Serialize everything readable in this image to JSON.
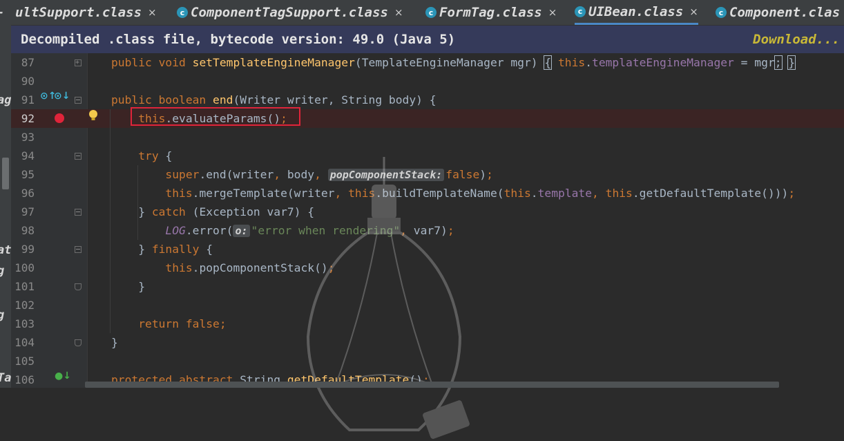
{
  "left_strip": {
    "fragments": [
      "-",
      "ag",
      "at",
      "g",
      "g",
      "Ta"
    ]
  },
  "tabs": [
    {
      "label": "ultSupport.class",
      "icon": "class-icon",
      "active": false
    },
    {
      "label": "ComponentTagSupport.class",
      "icon": "class-icon",
      "active": false
    },
    {
      "label": "FormTag.class",
      "icon": "class-icon",
      "active": false
    },
    {
      "label": "UIBean.class",
      "icon": "class-icon",
      "active": true
    },
    {
      "label": "Component.clas",
      "icon": "class-icon",
      "active": false
    }
  ],
  "tab_close_glyph": "×",
  "class_icon_glyph": "c",
  "banner": {
    "text": "Decompiled .class file, bytecode version: 49.0 (Java 5)",
    "link": "Download..."
  },
  "lines": [
    {
      "n": "87",
      "segments": [
        [
          "kw",
          "public void "
        ],
        [
          "fn",
          "setTemplateEngineManager"
        ],
        [
          "",
          "(TemplateEngineManager mgr) "
        ],
        [
          "bracket",
          "{"
        ],
        [
          "",
          ""
        ],
        [
          "kw",
          " this"
        ],
        [
          "",
          "."
        ],
        [
          "fld",
          "templateEngineManager"
        ],
        [
          "",
          " = mgr"
        ],
        [
          "bracket",
          ";"
        ],
        [
          "",
          " "
        ],
        [
          "bracket",
          "}"
        ]
      ]
    },
    {
      "n": "90",
      "segments": []
    },
    {
      "n": "91",
      "segments": [
        [
          "kw",
          "public boolean "
        ],
        [
          "fn",
          "end"
        ],
        [
          "",
          "(Writer writer, String body) {"
        ]
      ]
    },
    {
      "n": "92",
      "segments": [
        [
          "",
          "    "
        ],
        [
          "kw",
          "this"
        ],
        [
          "",
          ".evaluateParams()"
        ],
        [
          "kw",
          ";"
        ]
      ]
    },
    {
      "n": "93",
      "segments": []
    },
    {
      "n": "94",
      "segments": [
        [
          "",
          "    "
        ],
        [
          "kw",
          "try "
        ],
        [
          "",
          "{"
        ]
      ]
    },
    {
      "n": "95",
      "segments": [
        [
          "",
          "        "
        ],
        [
          "kw",
          "super"
        ],
        [
          "",
          ".end(writer"
        ],
        [
          "kw",
          ", "
        ],
        [
          "",
          "body"
        ],
        [
          "kw",
          ", "
        ],
        [
          "hint",
          "popComponentStack:"
        ],
        [
          "kw",
          "false"
        ],
        [
          "",
          ")"
        ],
        [
          "kw",
          ";"
        ]
      ]
    },
    {
      "n": "96",
      "segments": [
        [
          "",
          "        "
        ],
        [
          "kw",
          "this"
        ],
        [
          "",
          ".mergeTemplate(writer"
        ],
        [
          "kw",
          ", this"
        ],
        [
          "",
          ".buildTemplateName("
        ],
        [
          "kw",
          "this"
        ],
        [
          "",
          "."
        ],
        [
          "fld",
          "template"
        ],
        [
          "kw",
          ", this"
        ],
        [
          "",
          ".getDefaultTemplate()))"
        ],
        [
          "kw",
          ";"
        ]
      ]
    },
    {
      "n": "97",
      "segments": [
        [
          "",
          "    } "
        ],
        [
          "kw",
          "catch "
        ],
        [
          "",
          "(Exception var7) {"
        ]
      ]
    },
    {
      "n": "98",
      "segments": [
        [
          "",
          "        "
        ],
        [
          "itfld",
          "LOG"
        ],
        [
          "",
          ".error("
        ],
        [
          "hint",
          "o:"
        ],
        [
          "str",
          "\"error when rendering\""
        ],
        [
          "kw",
          ", "
        ],
        [
          "",
          "var7)"
        ],
        [
          "kw",
          ";"
        ]
      ]
    },
    {
      "n": "99",
      "segments": [
        [
          "",
          "    } "
        ],
        [
          "kw",
          "finally "
        ],
        [
          "",
          "{"
        ]
      ]
    },
    {
      "n": "100",
      "segments": [
        [
          "",
          "        "
        ],
        [
          "kw",
          "this"
        ],
        [
          "",
          ".popComponentStack()"
        ],
        [
          "kw",
          ";"
        ]
      ]
    },
    {
      "n": "101",
      "segments": [
        [
          "",
          "    }"
        ]
      ]
    },
    {
      "n": "102",
      "segments": []
    },
    {
      "n": "103",
      "segments": [
        [
          "",
          "    "
        ],
        [
          "kw",
          "return false;"
        ]
      ]
    },
    {
      "n": "104",
      "segments": [
        [
          "",
          "}"
        ]
      ]
    },
    {
      "n": "105",
      "segments": []
    },
    {
      "n": "106",
      "segments": [
        [
          "kw",
          "protected abstract "
        ],
        [
          "",
          "String "
        ],
        [
          "fn",
          "getDefaultTemplate"
        ],
        [
          "",
          "()"
        ],
        [
          "kw",
          ";"
        ]
      ]
    }
  ],
  "current_line": "92",
  "colors": {
    "keyword": "#cc7832",
    "field": "#9876aa",
    "method": "#ffc66d",
    "string": "#6a8759",
    "text": "#a9b7c6",
    "breakpoint": "#e0243a",
    "highlight_box": "#e0243a",
    "banner_bg": "#353a5a",
    "link": "#c8b837"
  }
}
